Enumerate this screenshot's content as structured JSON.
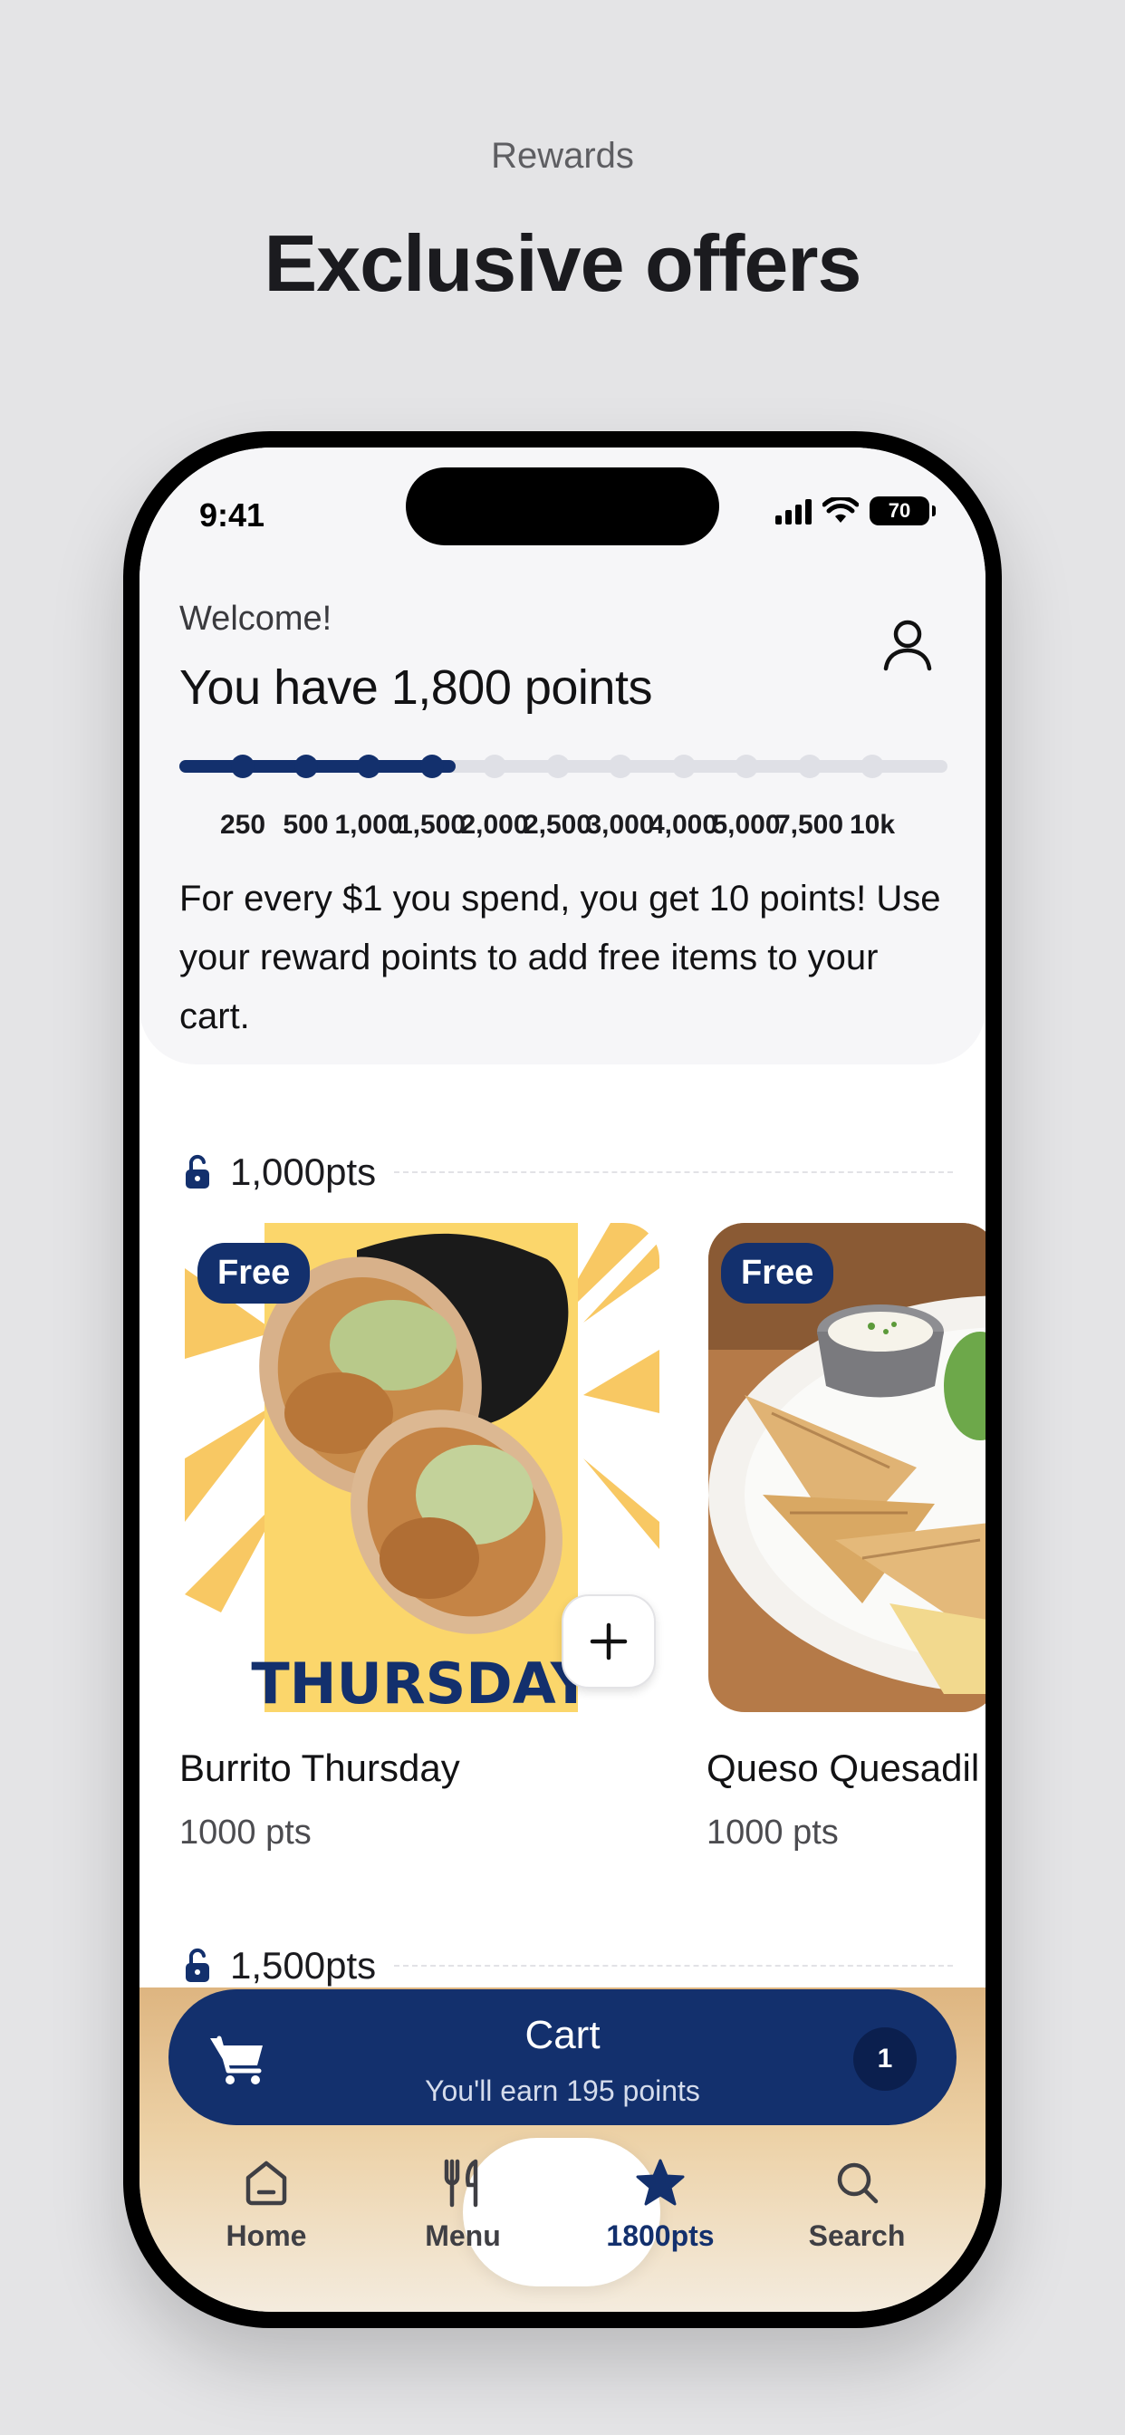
{
  "page": {
    "eyebrow": "Rewards",
    "headline": "Exclusive offers"
  },
  "status_bar": {
    "time": "9:41",
    "battery": "70"
  },
  "header": {
    "welcome": "Welcome!",
    "points_title": "You have 1,800 points",
    "progress_fraction": 0.36,
    "milestones": [
      "250",
      "500",
      "1,000",
      "1,500",
      "2,000",
      "2,500",
      "3,000",
      "4,000",
      "5,000",
      "7,500",
      "10k"
    ],
    "milestones_reached": 4,
    "info": "For every $1 you spend, you get 10 points! Use your reward points to add free items to your cart."
  },
  "tiers": [
    {
      "label": "1,000pts"
    },
    {
      "label": "1,500pts"
    }
  ],
  "items": [
    {
      "badge": "Free",
      "name": "Burrito Thursday",
      "points": "1000 pts",
      "image_text": "THURSDAY"
    },
    {
      "badge": "Free",
      "name": "Queso Quesadil",
      "points": "1000 pts"
    }
  ],
  "cart": {
    "title": "Cart",
    "subtitle": "You'll earn 195 points",
    "count": "1"
  },
  "nav": {
    "home": "Home",
    "menu": "Menu",
    "rewards": "1800pts",
    "search": "Search"
  },
  "colors": {
    "primary": "#13306d",
    "background": "#e4e4e6",
    "track": "#dfe0e6"
  }
}
